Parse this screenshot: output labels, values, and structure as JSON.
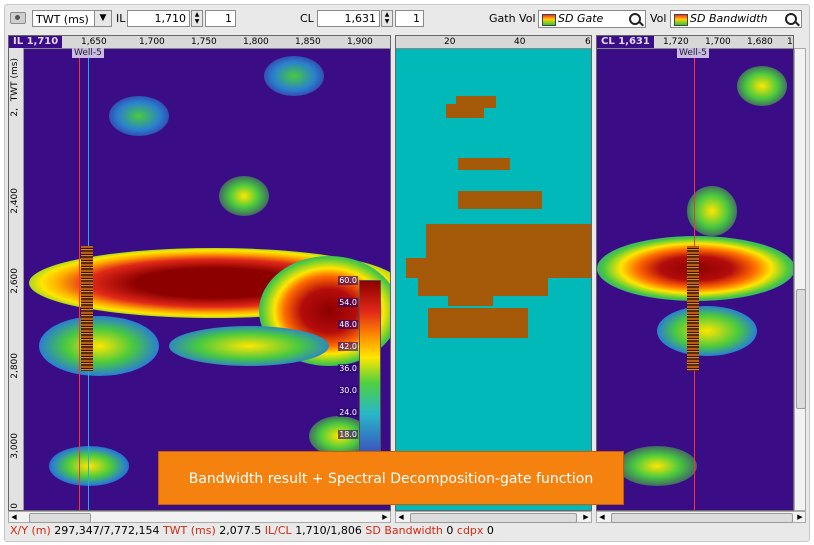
{
  "toolbar": {
    "domain_select": "TWT (ms)",
    "il_label": "IL",
    "il_value": "1,710",
    "il_step": "1",
    "cl_label": "CL",
    "cl_value": "1,631",
    "cl_step": "1",
    "gath_vol_label": "Gath Vol",
    "gath_vol_value": "SD Gate",
    "vol_label": "Vol",
    "vol_value": "SD Bandwidth"
  },
  "left_panel": {
    "corner": "IL 1,710",
    "x_ticks": [
      "1,650",
      "1,700",
      "1,750",
      "1,800",
      "1,850",
      "1,900"
    ],
    "y_title": "TWT (ms)",
    "y_ticks": [
      "2,",
      "2,400",
      "2,600",
      "2,800",
      "3,000",
      "0"
    ],
    "well_label": "Well-5"
  },
  "middle_panel": {
    "x_ticks": [
      "20",
      "40",
      "6"
    ]
  },
  "right_panel": {
    "corner": "CL 1,631",
    "x_ticks": [
      "1,720",
      "1,700",
      "1,680",
      "1"
    ],
    "well_label": "Well-5"
  },
  "colorbar": {
    "labels": [
      "60.0",
      "54.0",
      "48.0",
      "42.0",
      "36.0",
      "30.0",
      "24.0",
      "18.0"
    ]
  },
  "banner": "Bandwidth result + Spectral Decomposition-gate function",
  "status": {
    "xy_label": "X/Y (m)",
    "xy_value": "297,347/7,772,154",
    "twt_label": "TWT (ms)",
    "twt_value": "2,077.5",
    "ilcl_label": "IL/CL",
    "ilcl_value": "1,710/1,806",
    "sd_label": "SD Bandwidth",
    "sd_value": "0",
    "cdpx_label": "cdpx",
    "cdpx_value": "0"
  },
  "colors": {
    "background_purple": "#3a0d87",
    "teal": "#00b9b8",
    "brown": "#a45a08",
    "banner": "#f5820f",
    "status_key": "#d42a14"
  }
}
